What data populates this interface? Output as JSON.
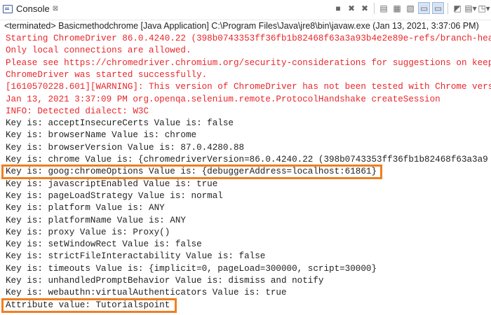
{
  "tab": {
    "label": "Console",
    "close": "⊠"
  },
  "toolbar": {
    "icons": [
      "terminate-icon",
      "remove-launch-icon",
      "remove-all-icon",
      "clear-console-icon",
      "scroll-lock-icon",
      "word-wrap-icon",
      "show-stdout-icon",
      "show-stderr-icon",
      "pin-console-icon",
      "display-console-icon",
      "new-console-icon"
    ]
  },
  "status": "<terminated> Basicmethodchrome [Java Application] C:\\Program Files\\Java\\jre8\\bin\\javaw.exe (Jan 13, 2021, 3:37:06 PM)",
  "lines": [
    {
      "text": "Starting ChromeDriver 86.0.4240.22 (398b0743353ff36fb1b82468f63a3a93b4e2e89e-refs/branch-heads",
      "kind": "err"
    },
    {
      "text": "Only local connections are allowed.",
      "kind": "err"
    },
    {
      "text": "Please see https://chromedriver.chromium.org/security-considerations for suggestions on keeping",
      "kind": "err"
    },
    {
      "text": "ChromeDriver was started successfully.",
      "kind": "err"
    },
    {
      "text": "[1610570228.601][WARNING]: This version of ChromeDriver has not been tested with Chrome version",
      "kind": "err"
    },
    {
      "text": "Jan 13, 2021 3:37:09 PM org.openqa.selenium.remote.ProtocolHandshake createSession",
      "kind": "err"
    },
    {
      "text": "INFO: Detected dialect: W3C",
      "kind": "err"
    },
    {
      "text": "Key is: acceptInsecureCerts Value is: false",
      "kind": "out"
    },
    {
      "text": "Key is: browserName Value is: chrome",
      "kind": "out"
    },
    {
      "text": "Key is: browserVersion Value is: 87.0.4280.88",
      "kind": "out"
    },
    {
      "text": "Key is: chrome Value is: {chromedriverVersion=86.0.4240.22 (398b0743353ff36fb1b82468f63a3a9",
      "kind": "out"
    },
    {
      "text": "Key is: goog:chromeOptions Value is: {debuggerAddress=localhost:61861}",
      "kind": "out"
    },
    {
      "text": "Key is: javascriptEnabled Value is: true",
      "kind": "out"
    },
    {
      "text": "Key is: pageLoadStrategy Value is: normal",
      "kind": "out"
    },
    {
      "text": "Key is: platform Value is: ANY",
      "kind": "out"
    },
    {
      "text": "Key is: platformName Value is: ANY",
      "kind": "out"
    },
    {
      "text": "Key is: proxy Value is: Proxy()",
      "kind": "out"
    },
    {
      "text": "Key is: setWindowRect Value is: false",
      "kind": "out"
    },
    {
      "text": "Key is: strictFileInteractability Value is: false",
      "kind": "out"
    },
    {
      "text": "Key is: timeouts Value is: {implicit=0, pageLoad=300000, script=30000}",
      "kind": "out"
    },
    {
      "text": "Key is: unhandledPromptBehavior Value is: dismiss and notify",
      "kind": "out"
    },
    {
      "text": "Key is: webauthn:virtualAuthenticators Value is: true",
      "kind": "out"
    },
    {
      "text": "Attribute value: Tutorialspoint",
      "kind": "out"
    }
  ],
  "colors": {
    "error": "#e8262a",
    "output": "#222222",
    "highlight": "#f07f1e"
  }
}
